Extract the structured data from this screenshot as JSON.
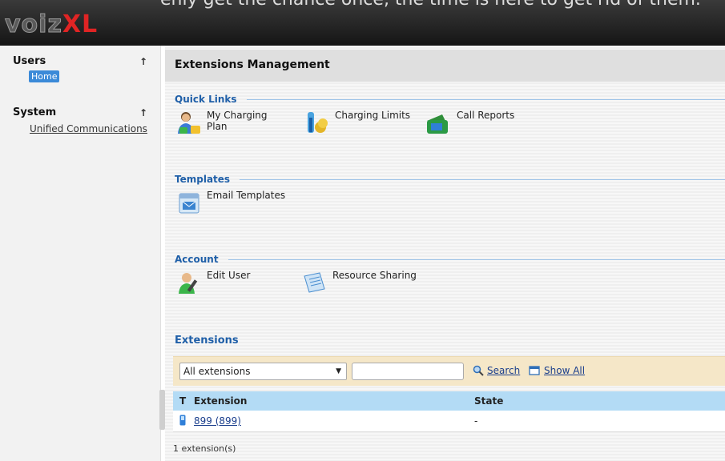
{
  "app": {
    "logo_part1": "voiz",
    "logo_part2": "XL",
    "top_hint": "enly get the chance once, the time is here to get rid of them."
  },
  "sidebar": {
    "sections": [
      {
        "title": "Users",
        "items": [
          {
            "label": "Home",
            "active": true
          }
        ]
      },
      {
        "title": "System",
        "items": [
          {
            "label": "Unified Communications",
            "active": false
          }
        ]
      }
    ],
    "collapse_icon": "arrow-up-icon"
  },
  "page": {
    "title": "Extensions Management"
  },
  "quick_links": {
    "title": "Quick Links",
    "items": [
      {
        "label": "My Charging Plan",
        "icon": "user-charging-icon"
      },
      {
        "label": "Charging Limits",
        "icon": "thermometer-coins-icon"
      },
      {
        "label": "Call Reports",
        "icon": "wallet-report-icon"
      }
    ]
  },
  "templates": {
    "title": "Templates",
    "items": [
      {
        "label": "Email Templates",
        "icon": "email-calendar-icon"
      }
    ]
  },
  "account": {
    "title": "Account",
    "items": [
      {
        "label": "Edit User",
        "icon": "edit-user-icon"
      },
      {
        "label": "Resource Sharing",
        "icon": "resource-sharing-icon"
      }
    ]
  },
  "extensions": {
    "title": "Extensions",
    "filter": {
      "selected": "All extensions",
      "search_value": ""
    },
    "search_label": "Search",
    "show_all_label": "Show All",
    "columns": [
      "T",
      "Extension",
      "State"
    ],
    "rows": [
      {
        "type_icon": "phone-icon",
        "extension": "899 (899)",
        "state": "-"
      }
    ],
    "count_text": "1 extension(s)"
  },
  "colors": {
    "accent": "#1f5fa8",
    "home_pill": "#3b8ad8",
    "table_header": "#b3dbf5",
    "filter_bar": "#f5e7c8"
  }
}
